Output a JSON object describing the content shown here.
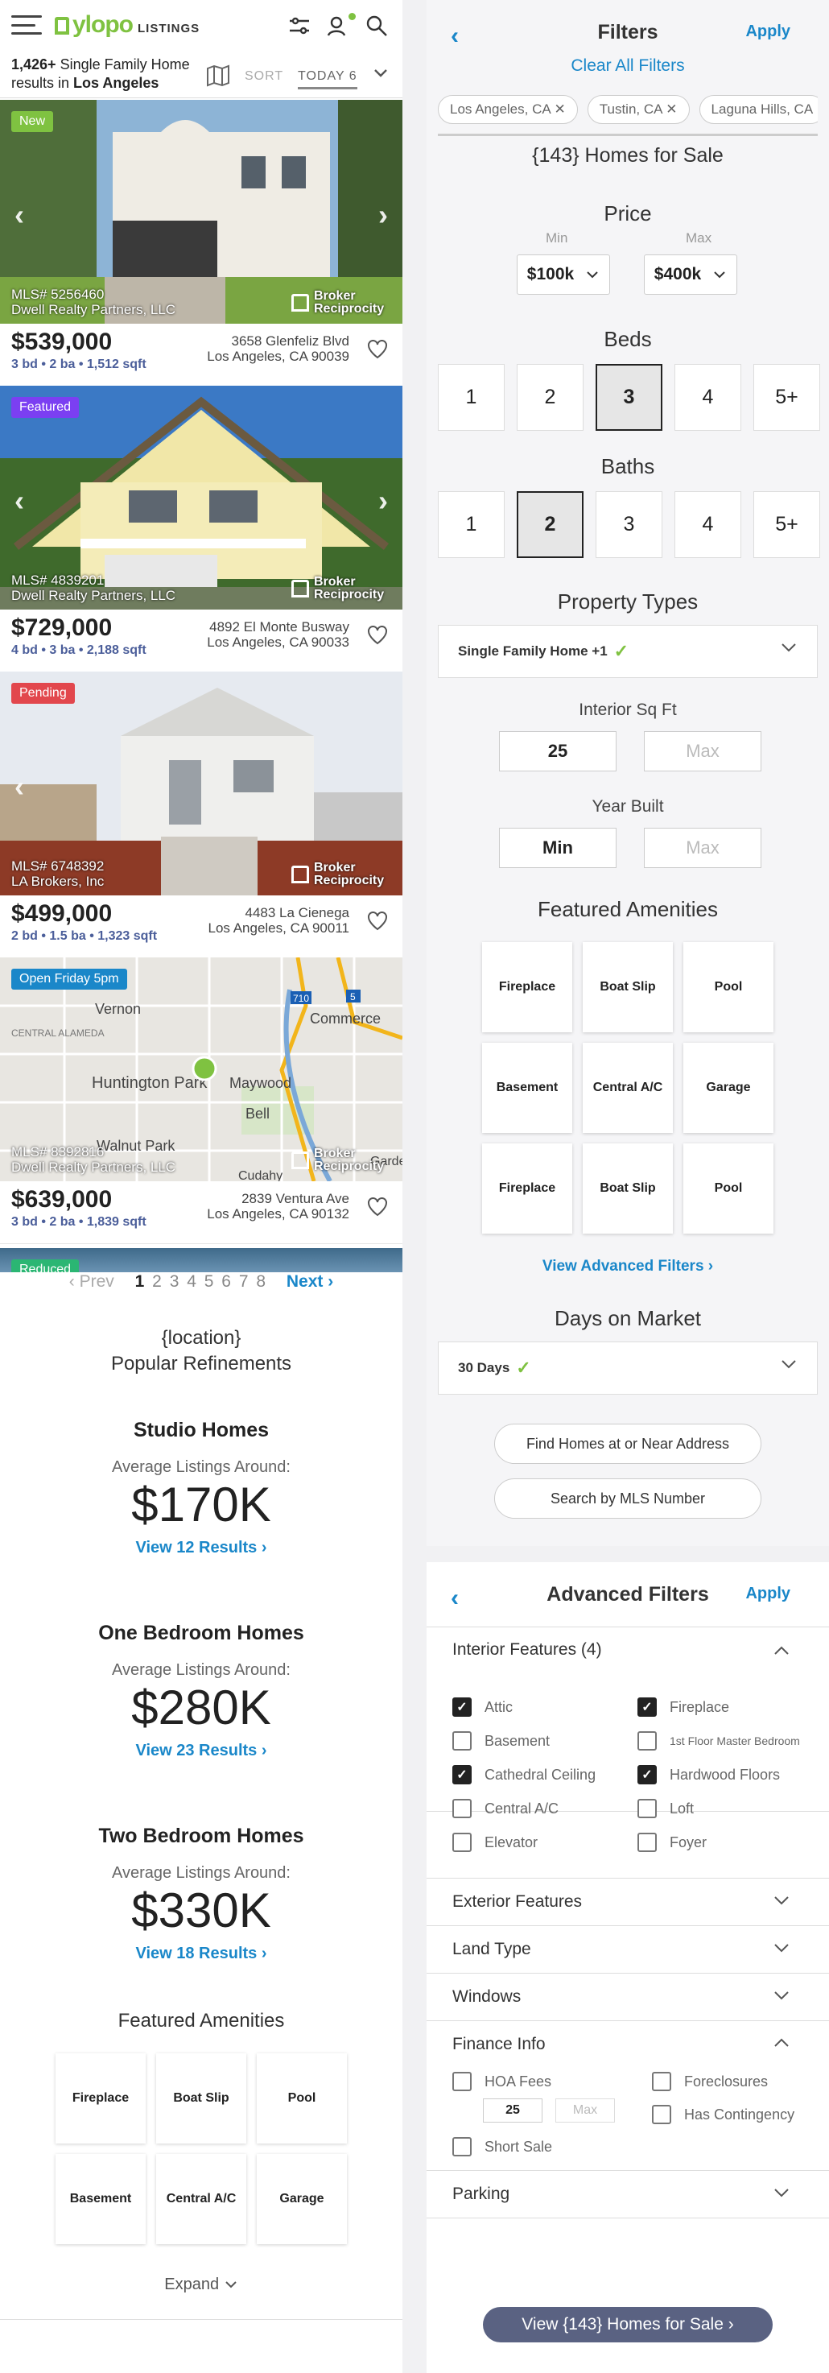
{
  "header": {
    "brand": "ylopo",
    "brand_sub": "LISTINGS",
    "results_count": "1,426+",
    "results_text": " Single Family Home results in ",
    "results_location": "Los Angeles",
    "sort_label": "SORT",
    "sort_value": "TODAY 6"
  },
  "listings": [
    {
      "badge": "New",
      "badge_color": "#7fc241",
      "mls": "MLS# 5256460",
      "broker": "Dwell Realty Partners, LLC",
      "price": "$539,000",
      "meta": "3 bd • 2 ba • 1,512 sqft",
      "addr1": "3658 Glenfeliz Blvd",
      "addr2": "Los Angeles, CA 90039"
    },
    {
      "badge": "Featured",
      "badge_color": "#7b3ff2",
      "mls": "MLS# 4839201",
      "broker": "Dwell Realty Partners, LLC",
      "price": "$729,000",
      "meta": "4 bd • 3 ba • 2,188 sqft",
      "addr1": "4892 El Monte Busway",
      "addr2": "Los Angeles, CA 90033"
    },
    {
      "badge": "Pending",
      "badge_color": "#e2474d",
      "mls": "MLS# 6748392",
      "broker": "LA Brokers, Inc",
      "price": "$499,000",
      "meta": "2 bd • 1.5 ba • 1,323 sqft",
      "addr1": "4483 La Cienega",
      "addr2": "Los Angeles, CA 90011"
    },
    {
      "badge": "Open Friday 5pm",
      "badge_color": "#1a87c9",
      "mls": "MLS# 8392816",
      "broker": "Dwell Realty Partners, LLC",
      "price": "$639,000",
      "meta": "3 bd • 2 ba • 1,839 sqft",
      "addr1": "2839 Ventura Ave",
      "addr2": "Los Angeles, CA 90132"
    }
  ],
  "broker_reciprocity": "Broker Reciprocity",
  "partial_badge": "Reduced",
  "map_labels": [
    "Vernon",
    "CENTRAL ALAMEDA",
    "Commerce",
    "Huntington Park",
    "Maywood",
    "Bell",
    "Walnut Park",
    "Cudahy",
    "Garden",
    "710",
    "5"
  ],
  "pagination": {
    "prev": "‹ Prev",
    "pages": [
      "1",
      "2",
      "3",
      "4",
      "5",
      "6",
      "7",
      "8"
    ],
    "current": "1",
    "next": "Next ›"
  },
  "refinements": {
    "location": "{location}",
    "title": "Popular Refinements",
    "avg_label": "Average Listings Around:",
    "groups": [
      {
        "title": "Studio Homes",
        "value": "$170K",
        "link": "View 12 Results ›"
      },
      {
        "title": "One Bedroom Homes",
        "value": "$280K",
        "link": "View 23 Results ›"
      },
      {
        "title": "Two Bedroom Homes",
        "value": "$330K",
        "link": "View 18 Results ›"
      }
    ],
    "amenities_title": "Featured Amenities",
    "amenities": [
      "Fireplace",
      "Boat Slip",
      "Pool",
      "Basement",
      "Central A/C",
      "Garage"
    ],
    "expand": "Expand"
  },
  "filters": {
    "title": "Filters",
    "apply": "Apply",
    "clear_all": "Clear All Filters",
    "chips": [
      "Los Angeles, CA",
      "Tustin, CA",
      "Laguna Hills, CA"
    ],
    "homes_for_sale": "{143} Homes for Sale",
    "price_title": "Price",
    "min_label": "Min",
    "max_label": "Max",
    "price_min": "$100k",
    "price_max": "$400k",
    "beds_title": "Beds",
    "beds": [
      "1",
      "2",
      "3",
      "4",
      "5+"
    ],
    "beds_selected": "3",
    "baths_title": "Baths",
    "baths": [
      "1",
      "2",
      "3",
      "4",
      "5+"
    ],
    "baths_selected": "2",
    "property_types_title": "Property Types",
    "property_types_value": "Single Family Home +1",
    "sqft_title": "Interior Sq Ft",
    "sqft_min": "25",
    "sqft_max_placeholder": "Max",
    "year_title": "Year Built",
    "year_min": "Min",
    "year_max_placeholder": "Max",
    "amenities_title": "Featured Amenities",
    "amenities": [
      "Fireplace",
      "Boat Slip",
      "Pool",
      "Basement",
      "Central A/C",
      "Garage",
      "Fireplace",
      "Boat Slip",
      "Pool"
    ],
    "advanced_link": "View Advanced Filters ›",
    "dom_title": "Days on Market",
    "dom_value": "30 Days",
    "find_address": "Find Homes at or Near Address",
    "search_mls": "Search by MLS Number"
  },
  "advanced": {
    "title": "Advanced Filters",
    "apply": "Apply",
    "interior_title": "Interior Features (4)",
    "interior_left": [
      {
        "label": "Attic",
        "checked": true
      },
      {
        "label": "Basement",
        "checked": false
      },
      {
        "label": "Cathedral Ceiling",
        "checked": true
      },
      {
        "label": "Central A/C",
        "checked": false
      },
      {
        "label": "Elevator",
        "checked": false
      }
    ],
    "interior_right": [
      {
        "label": "Fireplace",
        "checked": true
      },
      {
        "label": "1st Floor Master Bedroom",
        "checked": false
      },
      {
        "label": "Hardwood Floors",
        "checked": true
      },
      {
        "label": "Loft",
        "checked": false
      },
      {
        "label": "Foyer",
        "checked": false
      }
    ],
    "exterior": "Exterior Features",
    "land": "Land Type",
    "windows": "Windows",
    "finance": "Finance Info",
    "hoa": "HOA Fees",
    "hoa_min": "25",
    "hoa_max_placeholder": "Max",
    "foreclosures": "Foreclosures",
    "contingency": "Has Contingency",
    "short_sale": "Short Sale",
    "parking": "Parking",
    "view_button": "View {143} Homes for Sale ›"
  }
}
